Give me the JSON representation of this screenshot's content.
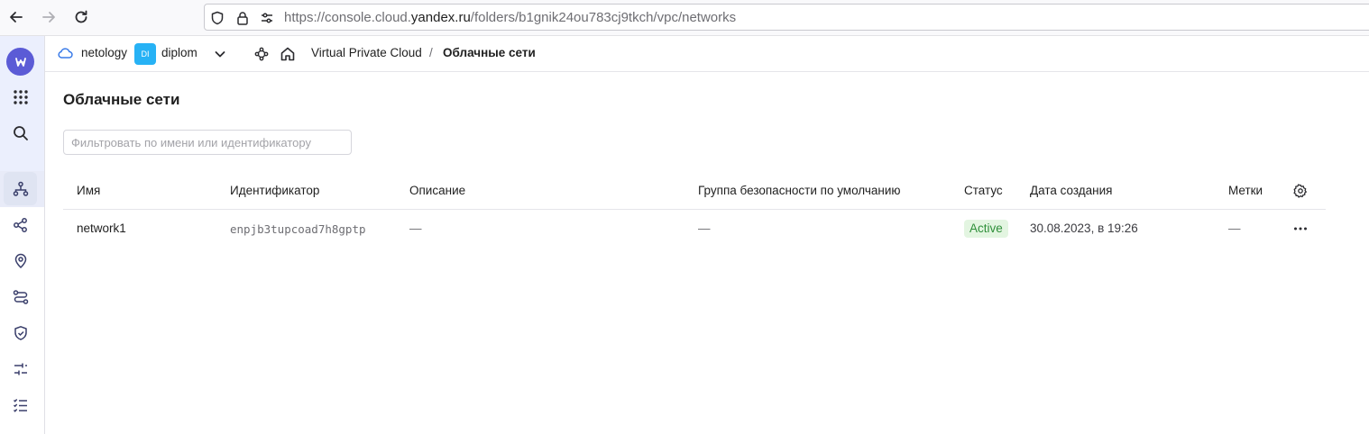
{
  "browser": {
    "url_prefix": "https://console.cloud.",
    "url_domain": "yandex.ru",
    "url_path": "/folders/b1gnik24ou783cj9tkch/vpc/networks"
  },
  "header": {
    "cloud_name": "netology",
    "folder_badge": "DI",
    "folder_name": "diplom",
    "breadcrumb_service": "Virtual Private Cloud",
    "breadcrumb_separator": "/",
    "breadcrumb_current": "Облачные сети"
  },
  "page": {
    "title": "Облачные сети",
    "filter_placeholder": "Фильтровать по имени или идентификатору"
  },
  "table": {
    "columns": {
      "name": "Имя",
      "id": "Идентификатор",
      "description": "Описание",
      "security_group": "Группа безопасности по умолчанию",
      "status": "Статус",
      "created": "Дата создания",
      "labels": "Метки"
    },
    "rows": [
      {
        "name": "network1",
        "id": "enpjb3tupcoad7h8gptp",
        "description": "—",
        "security_group": "—",
        "status": "Active",
        "created": "30.08.2023, в 19:26",
        "labels": "—"
      }
    ]
  },
  "colors": {
    "accent": "#5b5bd6",
    "folder_badge": "#27b2f5",
    "status_active_bg": "#e3f5e1",
    "status_active_text": "#2f8f3a"
  },
  "icons": {
    "rail": [
      "logo-icon",
      "apps-grid-icon",
      "search-icon",
      "vpc-network-icon",
      "share-nodes-icon",
      "location-pin-icon",
      "routes-icon",
      "shield-icon",
      "sliders-icon",
      "list-check-icon"
    ]
  }
}
